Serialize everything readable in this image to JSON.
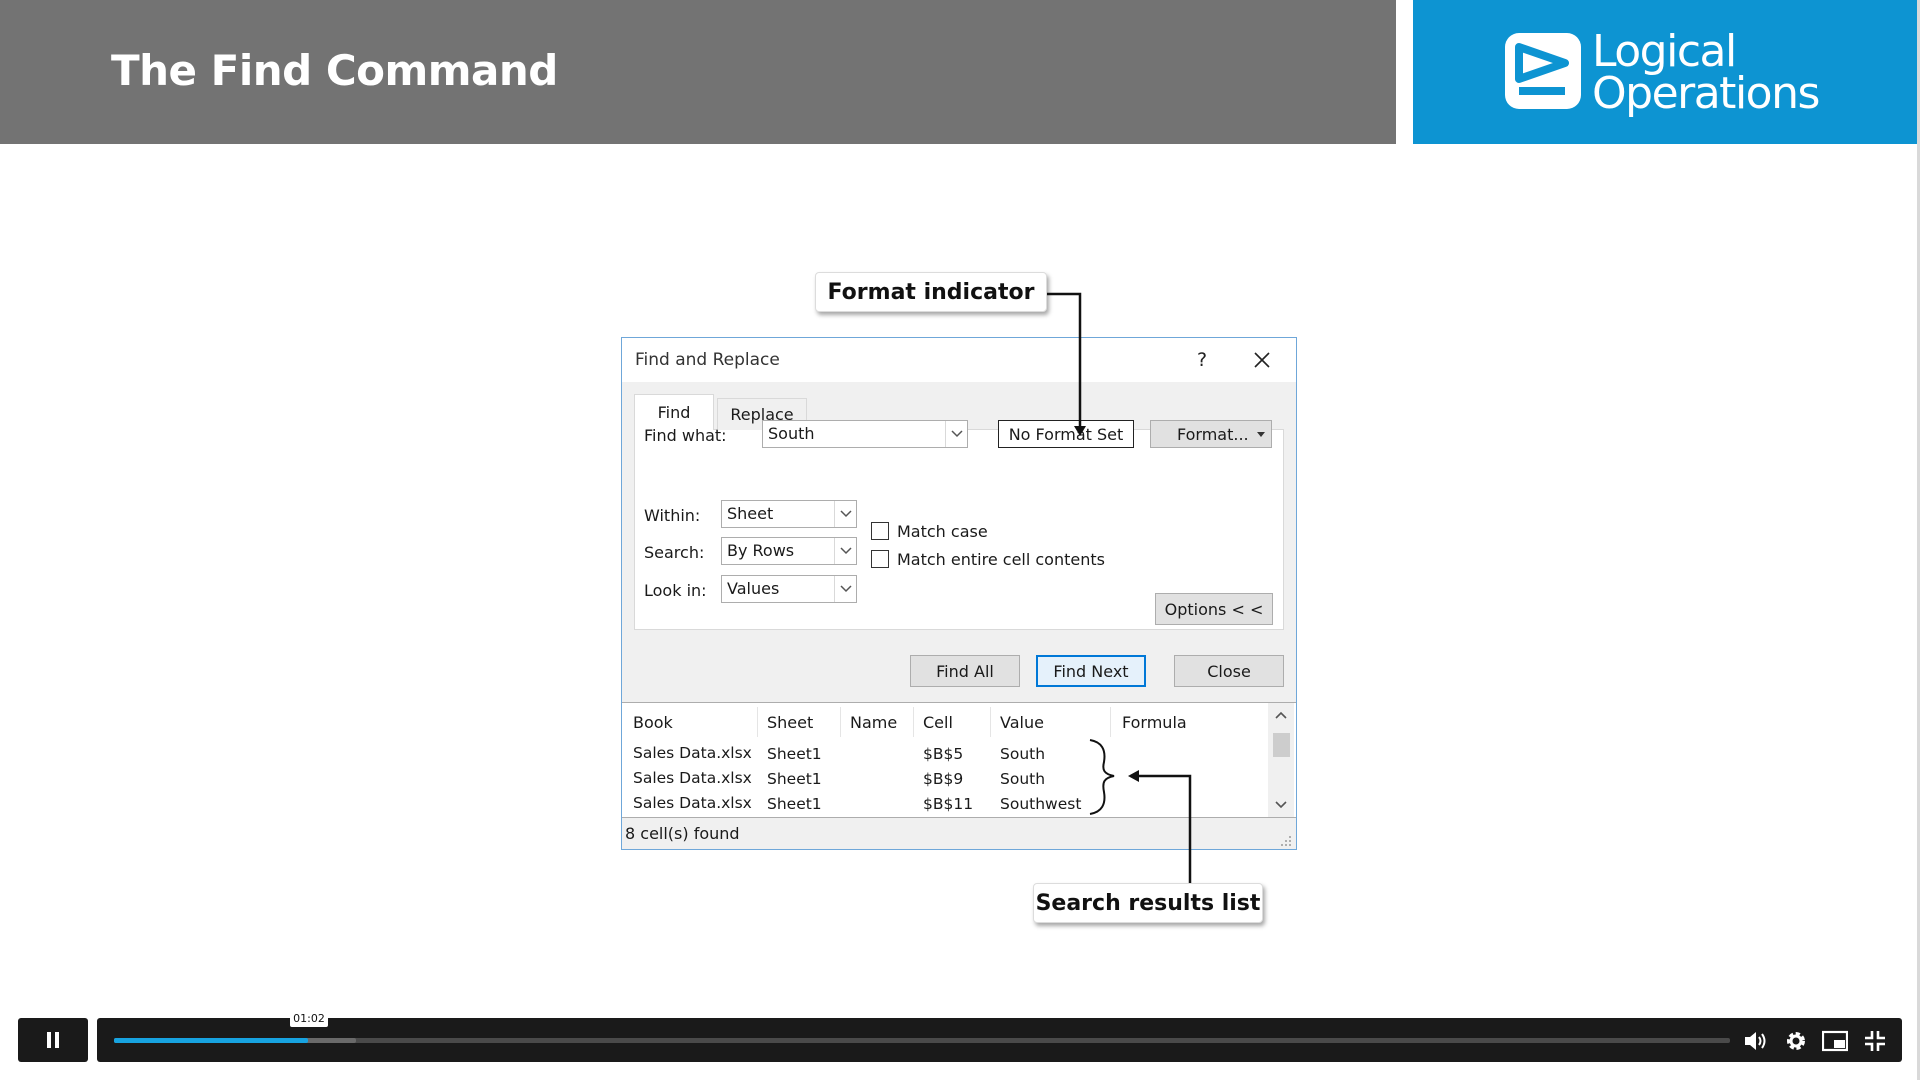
{
  "slide": {
    "title": "The Find Command",
    "logo_line1": "Logical",
    "logo_line2": "Operations"
  },
  "callouts": {
    "format_indicator": "Format indicator",
    "search_results": "Search results list"
  },
  "dialog": {
    "title": "Find and Replace",
    "help": "?",
    "tabs": [
      {
        "label": "Find",
        "active": true
      },
      {
        "label": "Replace",
        "active": false
      }
    ],
    "find_what_label": "Find what:",
    "find_what_value": "South",
    "format_indicator": "No Format Set",
    "format_button": "Format...",
    "within_label": "Within:",
    "within_value": "Sheet",
    "search_label": "Search:",
    "search_value": "By Rows",
    "lookin_label": "Look in:",
    "lookin_value": "Values",
    "match_case": {
      "label": "Match case",
      "checked": false
    },
    "match_entire": {
      "label": "Match entire cell contents",
      "checked": false
    },
    "options_button": "Options < <",
    "find_all_button": "Find All",
    "find_next_button": "Find Next",
    "close_button": "Close",
    "results": {
      "columns": [
        "Book",
        "Sheet",
        "Name",
        "Cell",
        "Value",
        "Formula"
      ],
      "rows": [
        {
          "book": "Sales Data.xlsx",
          "sheet": "Sheet1",
          "name": "",
          "cell": "$B$5",
          "value": "South",
          "formula": ""
        },
        {
          "book": "Sales Data.xlsx",
          "sheet": "Sheet1",
          "name": "",
          "cell": "$B$9",
          "value": "South",
          "formula": ""
        },
        {
          "book": "Sales Data.xlsx",
          "sheet": "Sheet1",
          "name": "",
          "cell": "$B$11",
          "value": "Southwest",
          "formula": ""
        }
      ]
    },
    "status": "8 cell(s) found"
  },
  "player": {
    "time": "01:02",
    "progress_fraction": 0.12,
    "buffered_fraction": 0.15,
    "accent_color": "#17a3e0"
  },
  "colors": {
    "header_gray": "#737373",
    "brand_blue": "#0d94d2"
  }
}
